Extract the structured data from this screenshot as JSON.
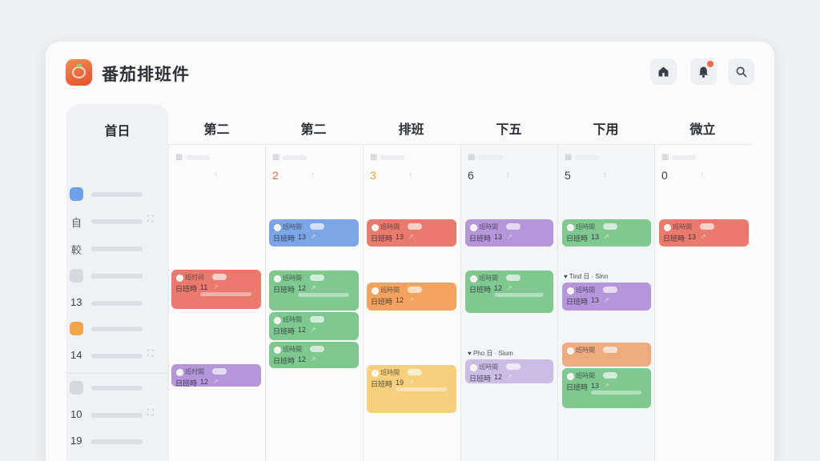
{
  "app": {
    "title": "番茄排班件",
    "logo_icon": "tomato-icon"
  },
  "header_buttons": [
    {
      "name": "home-icon"
    },
    {
      "name": "bell-icon",
      "badge": true
    },
    {
      "name": "search-icon"
    }
  ],
  "sidebar": {
    "heading": "首日",
    "rows": [
      {
        "type": "icon",
        "color": "#6fa0ea",
        "expand": false
      },
      {
        "type": "text",
        "text": "自",
        "expand": true
      },
      {
        "type": "text",
        "text": "較",
        "expand": false
      },
      {
        "type": "icon",
        "color": "#d6d8dd",
        "expand": false
      },
      {
        "type": "text",
        "text": "13",
        "expand": false
      },
      {
        "type": "icon",
        "color": "#f2a64a",
        "expand": false
      },
      {
        "type": "text",
        "text": "14",
        "expand": true
      },
      {
        "type": "icon",
        "color": "#d6d8dd",
        "expand": false
      },
      {
        "type": "text",
        "text": "10",
        "expand": true
      },
      {
        "type": "text",
        "text": "19",
        "expand": false
      }
    ],
    "expand_glyph": "⛶"
  },
  "days": [
    {
      "label": "第二",
      "num": "",
      "mark": "↑"
    },
    {
      "label": "第二",
      "num": "2",
      "mark": "↑",
      "accent": "#e06a50"
    },
    {
      "label": "排班",
      "num": "3",
      "mark": "↑",
      "accent": "#d3a53e"
    },
    {
      "label": "下五",
      "num": "6",
      "mark": "↑"
    },
    {
      "label": "下用",
      "num": "5",
      "mark": "↑"
    },
    {
      "label": "微立",
      "num": "0",
      "mark": "↑"
    }
  ],
  "events": [
    {
      "col": 0,
      "color": "red",
      "label": "班时间",
      "text": "日班時",
      "num": "11"
    },
    {
      "col": 0,
      "color": "purple",
      "label": "班时間",
      "text": "日班時",
      "num": "12"
    },
    {
      "col": 1,
      "color": "blue",
      "label": "班時間",
      "text": "日班時",
      "num": "13"
    },
    {
      "col": 1,
      "color": "green",
      "label": "班時間",
      "text": "日班時",
      "num": "12"
    },
    {
      "col": 1,
      "color": "green",
      "label": "班時間",
      "text": "日班時",
      "num": "12"
    },
    {
      "col": 1,
      "color": "green",
      "label": "班時間",
      "text": "日班時",
      "num": "12"
    },
    {
      "col": 2,
      "color": "red",
      "label": "班時間",
      "text": "日班時",
      "num": "13"
    },
    {
      "col": 2,
      "color": "orange",
      "label": "班時間",
      "text": "日班時",
      "num": "12"
    },
    {
      "col": 2,
      "color": "yellow",
      "label": "班時間",
      "text": "日班時",
      "num": "19"
    },
    {
      "col": 3,
      "color": "purple",
      "label": "班時間",
      "text": "日班時",
      "num": "13"
    },
    {
      "col": 3,
      "color": "green",
      "label": "班時間",
      "text": "日班時",
      "num": "12"
    },
    {
      "col": 3,
      "color": "lpurple",
      "label": "班時間",
      "text": "日班時",
      "num": "12",
      "note": "♥ Pho 日 · Sium"
    },
    {
      "col": 4,
      "color": "green",
      "label": "班時間",
      "text": "日班時",
      "num": "13"
    },
    {
      "col": 4,
      "color": "purple",
      "label": "班時間",
      "text": "日班時",
      "num": "13",
      "note": "♥ Tind 日 · Sinn"
    },
    {
      "col": 4,
      "color": "peach",
      "label": "班時間",
      "text": "",
      "num": ""
    },
    {
      "col": 4,
      "color": "green",
      "label": "班時間",
      "text": "日班時",
      "num": "13"
    },
    {
      "col": 5,
      "color": "red",
      "label": "班時間",
      "text": "日班時",
      "num": "13"
    }
  ]
}
